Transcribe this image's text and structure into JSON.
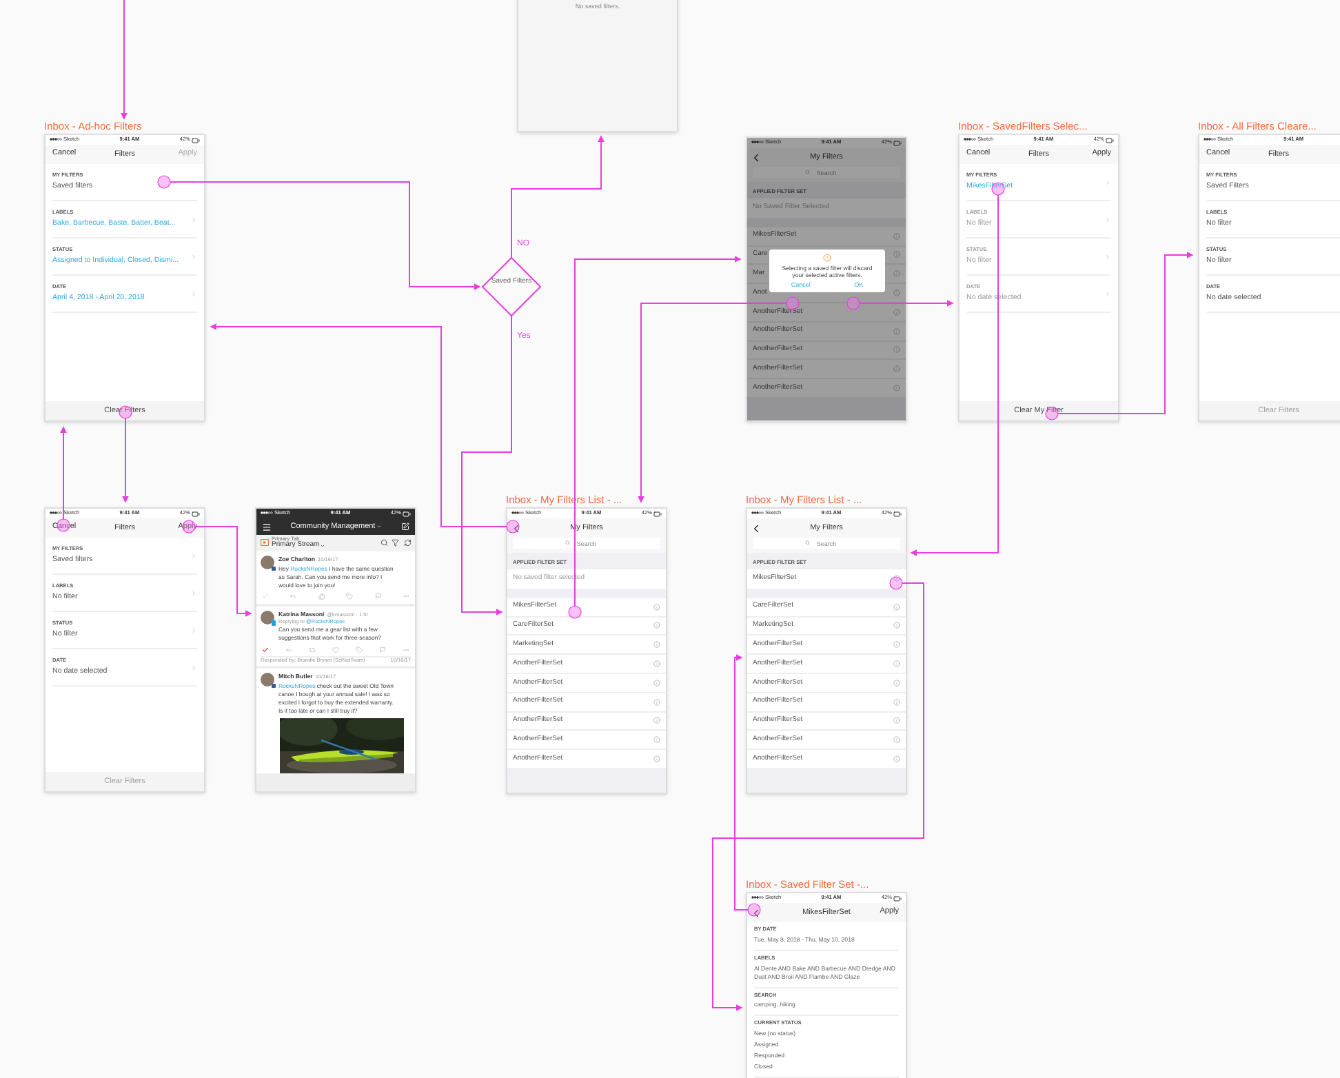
{
  "decision": {
    "label": "Saved Filters",
    "no": "NO",
    "yes": "Yes"
  },
  "screens": [
    {
      "kind": "blank",
      "message": "No saved filters."
    },
    {
      "kind": "filters",
      "title": "Inbox - Ad-hoc Filters",
      "status": {
        "carrier": "Sketch",
        "time": "9:41 AM",
        "battery": "42%"
      },
      "nav": {
        "left": "Cancel",
        "center": "Filters",
        "right": "Apply",
        "right_disabled": true
      },
      "chevrons": true,
      "sections": [
        {
          "label": "MY FILTERS",
          "value": "Saved filters",
          "applied": false,
          "disabled": false
        },
        {
          "label": "LABELS",
          "value": "Bake, Barbecue, Baste, Batter, Beat...",
          "applied": true,
          "disabled": false
        },
        {
          "label": "STATUS",
          "value": "Assigned to Individual, Closed, Dismi...",
          "applied": true,
          "disabled": false
        },
        {
          "label": "DATE",
          "value": "April 4, 2018 - April 20, 2018",
          "applied": true,
          "disabled": false
        }
      ],
      "footer": {
        "label": "Clear Filters",
        "disabled": false
      }
    },
    {
      "kind": "my_filters",
      "status": {
        "carrier": "Sketch",
        "time": "9:41 AM",
        "battery": "42%"
      },
      "nav": {
        "back": true,
        "center": "My Filters"
      },
      "search": {
        "placeholder": "Search"
      },
      "dimmed": true,
      "applied": {
        "label": "APPLIED FILTER SET",
        "value": "No Saved Filter Selected",
        "empty": true
      },
      "items": [
        {
          "name": "MikesFilterSet"
        },
        {
          "name": "Care"
        },
        {
          "name": "Mar"
        },
        {
          "name": "Anot"
        },
        {
          "name": "AnotherFilterSet"
        },
        {
          "name": "AnotherFilterSet"
        },
        {
          "name": "AnotherFilterSet"
        },
        {
          "name": "AnotherFilterSet"
        },
        {
          "name": "AnotherFilterSet"
        }
      ],
      "modal": {
        "message": "Selecting a saved filter will discard your selected active filters.",
        "cancel": "Cancel",
        "ok": "OK"
      }
    },
    {
      "kind": "filters",
      "title": "Inbox - SavedFilters Selec...",
      "status": {
        "carrier": "Sketch",
        "time": "9:41 AM",
        "battery": "42%"
      },
      "nav": {
        "left": "Cancel",
        "center": "Filters",
        "right": "Apply",
        "right_disabled": false
      },
      "chevrons": true,
      "sections": [
        {
          "label": "MY FILTERS",
          "value": "MikesFilterSet",
          "applied": true,
          "disabled": false
        },
        {
          "label": "LABELS",
          "value": "No filter",
          "applied": false,
          "disabled": true
        },
        {
          "label": "STATUS",
          "value": "No filter",
          "applied": false,
          "disabled": true
        },
        {
          "label": "DATE",
          "value": "No date selected",
          "applied": false,
          "disabled": true
        }
      ],
      "footer": {
        "label": "Clear My Filter",
        "disabled": false
      }
    },
    {
      "kind": "filters",
      "title": "Inbox - All Filters Cleare...",
      "status": {
        "carrier": "Sketch",
        "time": "9:41 AM"
      },
      "nav": {
        "left": "Cancel",
        "center": "Filters"
      },
      "chevrons": false,
      "sections": [
        {
          "label": "MY FILTERS",
          "value": "Saved Filters",
          "applied": false,
          "disabled": false
        },
        {
          "label": "LABELS",
          "value": "No filter",
          "applied": false,
          "disabled": false
        },
        {
          "label": "STATUS",
          "value": "No filter",
          "applied": false,
          "disabled": false
        },
        {
          "label": "DATE",
          "value": "No date selected",
          "applied": false,
          "disabled": false
        }
      ],
      "footer": {
        "label": "Clear Filters",
        "disabled": true
      }
    },
    {
      "kind": "filters",
      "status": {
        "carrier": "Sketch",
        "time": "9:41 AM",
        "battery": "42%"
      },
      "nav": {
        "left": "Cancel",
        "center": "Filters",
        "right": "Apply",
        "right_disabled": false
      },
      "chevrons": true,
      "sections": [
        {
          "label": "MY FILTERS",
          "value": "Saved filters",
          "applied": false,
          "disabled": false
        },
        {
          "label": "LABELS",
          "value": "No filter",
          "applied": false,
          "disabled": false
        },
        {
          "label": "STATUS",
          "value": "No filter",
          "applied": false,
          "disabled": false
        },
        {
          "label": "DATE",
          "value": "No date selected",
          "applied": false,
          "disabled": false
        }
      ],
      "footer": {
        "label": "Clear Filters",
        "disabled": true
      }
    },
    {
      "kind": "feed",
      "status": {
        "carrier": "Sketch",
        "time": "9:41 AM",
        "battery": "42%"
      },
      "header": "Community Management",
      "tab_label": "Primary Tab",
      "stream": "Primary Stream",
      "posts": [
        {
          "author": "Zoe Charlton",
          "meta": "10/16/17",
          "kind": "facebook",
          "checked": false,
          "body": [
            {
              "text": "Hey "
            },
            {
              "text": "RocksNRopes",
              "mention": true
            },
            {
              "text": " I have the same question as Sarah. Can you send me more info? I would love to join you!"
            }
          ]
        },
        {
          "author": "Katrina Massoni",
          "meta": "@kmassoni · 1 hr",
          "kind": "twitter",
          "checked": true,
          "reply_to": {
            "prefix": "Replying to",
            "handle": "@RocksNRopes"
          },
          "body": [
            {
              "text": "Can you send me a gear list with a few suggestions that work for three-season?"
            }
          ],
          "responded": {
            "text": "Responded by: Brandie Bryant (SciNetTeam)",
            "date": "10/16/17"
          }
        },
        {
          "author": "Mitch Butler",
          "meta": "10/16/17",
          "kind": "facebook",
          "body": [
            {
              "text": "RocksNRopes",
              "mention": true
            },
            {
              "text": " check out the sweet Old Town canoe I bough at your annual sale! I was so excited I forgot to buy the extended warranty. Is it too late or can I still buy it?"
            }
          ],
          "media": {
            "kind": "picture"
          }
        }
      ]
    },
    {
      "kind": "my_filters",
      "title": "Inbox - My Filters List - ...",
      "status": {
        "carrier": "Sketch",
        "time": "9:41 AM",
        "battery": "42%"
      },
      "nav": {
        "back": true,
        "center": "My Filters"
      },
      "search": {
        "placeholder": "Search"
      },
      "dimmed": false,
      "applied": {
        "label": "APPLIED FILTER SET",
        "value": "No saved filter selected",
        "empty": true
      },
      "items": [
        {
          "name": "MikesFilterSet"
        },
        {
          "name": "CareFilterSet"
        },
        {
          "name": "MarketingSet"
        },
        {
          "name": "AnotherFilterSet"
        },
        {
          "name": "AnotherFilterSet"
        },
        {
          "name": "AnotherFilterSet"
        },
        {
          "name": "AnotherFilterSet"
        },
        {
          "name": "AnotherFilterSet"
        },
        {
          "name": "AnotherFilterSet"
        }
      ]
    },
    {
      "kind": "my_filters",
      "title": "Inbox - My Filters List - ...",
      "status": {
        "carrier": "Sketch",
        "time": "9:41 AM",
        "battery": "42%"
      },
      "nav": {
        "back": true,
        "center": "My Filters"
      },
      "search": {
        "placeholder": "Search"
      },
      "dimmed": false,
      "applied": {
        "label": "APPLIED FILTER SET",
        "value": "MikesFilterSet",
        "empty": false
      },
      "items": [
        {
          "name": "CareFilterSet"
        },
        {
          "name": "MarketingSet"
        },
        {
          "name": "AnotherFilterSet"
        },
        {
          "name": "AnotherFilterSet"
        },
        {
          "name": "AnotherFilterSet"
        },
        {
          "name": "AnotherFilterSet"
        },
        {
          "name": "AnotherFilterSet"
        },
        {
          "name": "AnotherFilterSet"
        },
        {
          "name": "AnotherFilterSet"
        }
      ]
    },
    {
      "kind": "saved_set",
      "title": "Inbox - Saved Filter Set -...",
      "status": {
        "carrier": "Sketch",
        "time": "9:41 AM",
        "battery": "42%"
      },
      "nav": {
        "back": true,
        "center": "MikesFilterSet",
        "right": "Apply"
      },
      "sections": [
        {
          "label": "BY DATE",
          "lines": [
            "Tue, May 8, 2018 - Thu, May 10, 2018"
          ]
        },
        {
          "label": "LABELS",
          "lines": [
            "Al Dente AND Bake AND Barbecue AND Dredge AND Dust AND Broil AND Flambe AND Glaze"
          ]
        },
        {
          "label": "SEARCH",
          "lines": [
            "camping, hiking"
          ]
        },
        {
          "label": "CURRENT STATUS",
          "lines": [
            "New (no status)",
            "Assigned",
            "Responded",
            "Closed"
          ]
        }
      ]
    }
  ]
}
